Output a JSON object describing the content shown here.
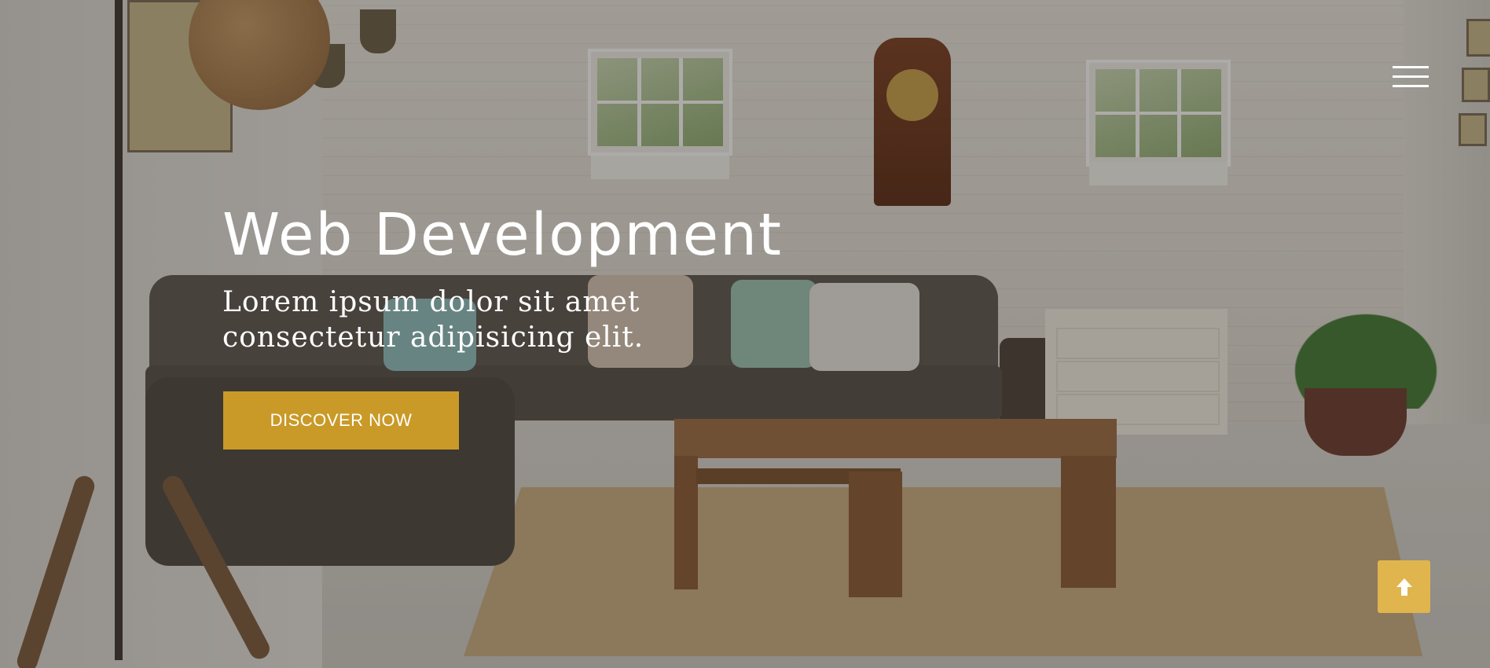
{
  "hero": {
    "title": "Web Development",
    "subtitle": "Lorem ipsum dolor sit amet consectetur adipisicing elit.",
    "cta_label": "DISCOVER NOW"
  },
  "header": {
    "menu_icon": "hamburger-menu-icon"
  },
  "scroll_top": {
    "icon": "arrow-up-icon"
  },
  "colors": {
    "accent": "#c99a27",
    "scroll_top_bg": "#e1b54d",
    "text": "#ffffff"
  }
}
